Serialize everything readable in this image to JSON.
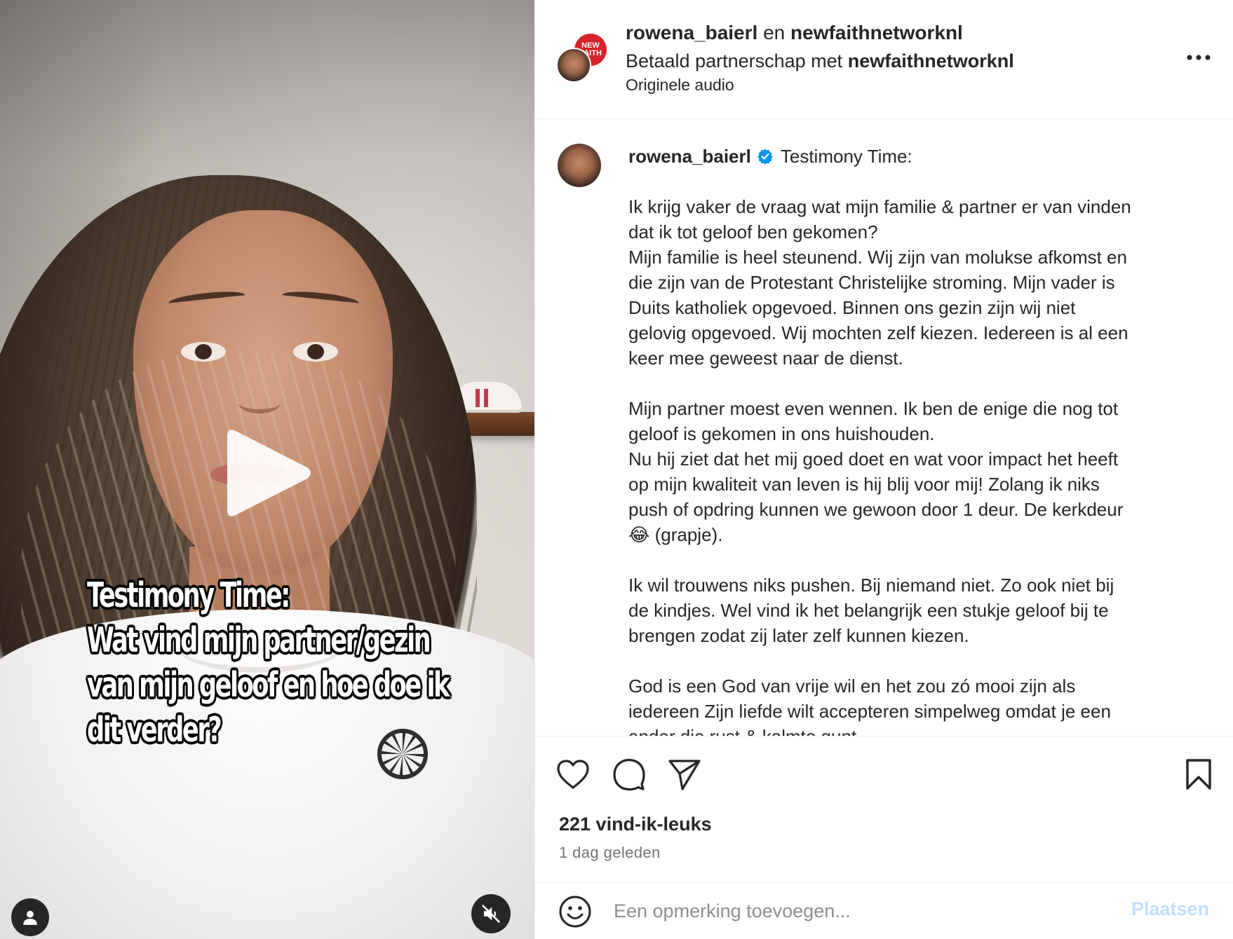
{
  "video": {
    "overlay_lines": [
      "Testimony Time:",
      "Wat vind mijn partner/gezin",
      "van mijn geloof en hoe doe ik",
      "dit verder?"
    ],
    "play_icon": "play-icon",
    "user_tag_icon": "user-icon",
    "mute_icon": "muted-speaker-icon"
  },
  "header": {
    "author": "rowena_baierl",
    "conjunction": "en",
    "collaborator": "newfaithnetworknl",
    "partnership_prefix": "Betaald partnerschap met",
    "partnership_brand": "newfaithnetworknl",
    "audio": "Originele audio",
    "brand_avatar_text": "NEW\nFAITH",
    "more_icon": "more-options-icon"
  },
  "caption": {
    "username": "rowena_baierl",
    "verified_icon": "verified-badge-icon",
    "title": "Testimony Time:",
    "paragraphs": [
      {
        "lines": [
          "Ik krijg vaker de vraag wat mijn familie & partner er van vinden",
          "dat ik tot geloof ben gekomen?",
          "Mijn familie is heel steunend. Wij zijn van molukse afkomst en",
          "die zijn van de Protestant Christelijke stroming. Mijn vader is",
          "Duits katholiek opgevoed. Binnen ons gezin zijn wij niet",
          "gelovig opgevoed. Wij mochten zelf kiezen. Iedereen is al een",
          "keer mee geweest naar de dienst."
        ]
      },
      {
        "lines": [
          "Mijn partner moest even wennen. Ik ben de enige die nog tot",
          "geloof is gekomen in ons huishouden.",
          "Nu hij ziet dat het mij goed doet en wat voor impact het heeft",
          "op mijn kwaliteit van leven is hij blij voor mij! Zolang ik niks",
          "push of opdring kunnen we gewoon door 1 deur. De kerkdeur",
          "😂 (grapje)."
        ]
      },
      {
        "lines": [
          "Ik wil trouwens niks pushen. Bij niemand niet. Zo ook niet bij",
          "de kindjes. Wel vind ik het belangrijk een stukje geloof bij te",
          "brengen zodat zij later zelf kunnen kiezen."
        ]
      },
      {
        "lines": [
          "God is een God van vrije wil en het zou zó mooi zijn als",
          "iedereen Zijn liefde wilt accepteren simpelweg omdat je een",
          "ander die rust & kalmte gunt."
        ]
      }
    ]
  },
  "actions": {
    "like_icon": "heart-icon",
    "comment_icon": "comment-icon",
    "share_icon": "share-icon",
    "save_icon": "bookmark-icon",
    "likes_text": "221 vind-ik-leuks",
    "timestamp": "1 dag geleden"
  },
  "comment": {
    "emoji_icon": "emoji-icon",
    "placeholder": "Een opmerking toevoegen...",
    "post_label": "Plaatsen",
    "post_color": "#c0dffd"
  },
  "colors": {
    "text": "#262626",
    "secondary": "#737373",
    "verified": "#0095f6",
    "brand_red": "#d8232a"
  }
}
